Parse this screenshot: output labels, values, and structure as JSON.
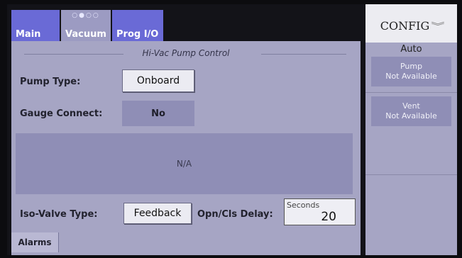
{
  "tabs": [
    {
      "label": "Main"
    },
    {
      "label": "Vacuum",
      "indicator": "○●○○"
    },
    {
      "label": "Prog I/O"
    }
  ],
  "section_title": "Hi-Vac Pump Control",
  "pump_type": {
    "label": "Pump Type:",
    "value": "Onboard"
  },
  "gauge_connect": {
    "label": "Gauge Connect:",
    "value": "No"
  },
  "status_area": {
    "text": "N/A"
  },
  "iso_valve": {
    "label": "Iso-Valve Type:",
    "value": "Feedback"
  },
  "delay": {
    "label": "Opn/Cls Delay:",
    "unit": "Seconds",
    "value": "20"
  },
  "alarms": {
    "label": "Alarms"
  },
  "config": {
    "title": "CONFIG",
    "mode": "Auto",
    "pump": {
      "line1": "Pump",
      "line2": "Not Available"
    },
    "vent": {
      "line1": "Vent",
      "line2": "Not Available"
    }
  }
}
